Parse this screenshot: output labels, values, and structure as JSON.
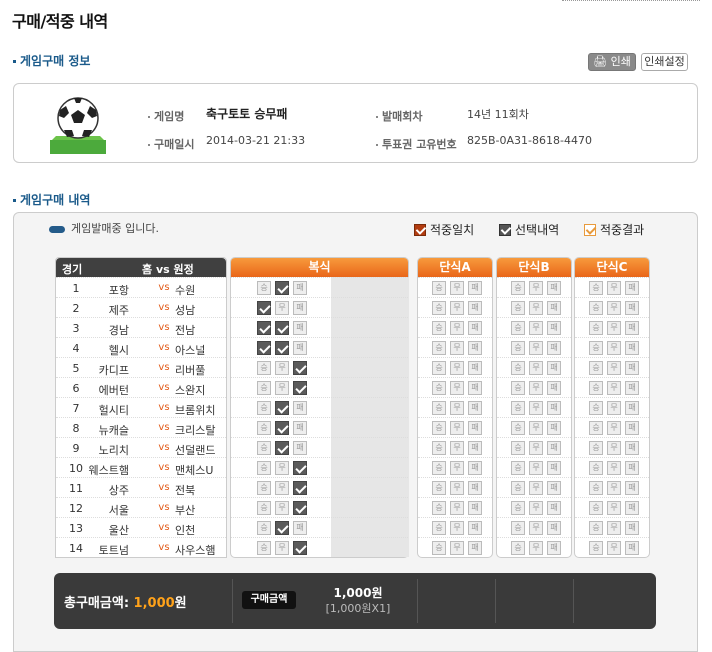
{
  "page_title": "구매/적중 내역",
  "info_section": {
    "title": "게임구매 정보",
    "print_label": "인쇄",
    "print_settings_label": "인쇄설정",
    "game_name_label": "게임명",
    "game_name": "축구토토 승무패",
    "round_label": "발매회차",
    "round": "14년 11회차",
    "purchase_time_label": "구매일시",
    "purchase_time": "2014-03-21 21:33",
    "ticket_id_label": "투표권 고유번호",
    "ticket_id": "825B-0A31-8618-4470"
  },
  "detail_section": {
    "title": "게임구매 내역",
    "status": "게임발매중 입니다.",
    "legend": {
      "hit_match": "적중일치",
      "selected": "선택내역",
      "hit_result": "적중결과"
    }
  },
  "table_headers": {
    "no": "경기",
    "home_vs_away": "홈 vs 원정",
    "multi": "복식",
    "single_a": "단식A",
    "single_b": "단식B",
    "single_c": "단식C"
  },
  "option_labels": {
    "win": "승",
    "draw": "무",
    "lose": "패"
  },
  "vs_text": "vs",
  "matches": [
    {
      "no": "1",
      "home": "포항",
      "away": "수원",
      "picks": [
        false,
        true,
        false
      ]
    },
    {
      "no": "2",
      "home": "제주",
      "away": "성남",
      "picks": [
        true,
        false,
        false
      ]
    },
    {
      "no": "3",
      "home": "경남",
      "away": "전남",
      "picks": [
        true,
        true,
        false
      ]
    },
    {
      "no": "4",
      "home": "헬시",
      "away": "아스널",
      "picks": [
        true,
        true,
        false
      ]
    },
    {
      "no": "5",
      "home": "카디프",
      "away": "리버풀",
      "picks": [
        false,
        false,
        true
      ]
    },
    {
      "no": "6",
      "home": "에버턴",
      "away": "스완지",
      "picks": [
        false,
        false,
        true
      ]
    },
    {
      "no": "7",
      "home": "헐시티",
      "away": "브롬위치",
      "picks": [
        false,
        true,
        false
      ]
    },
    {
      "no": "8",
      "home": "뉴캐슬",
      "away": "크리스탈",
      "picks": [
        false,
        true,
        false
      ]
    },
    {
      "no": "9",
      "home": "노리치",
      "away": "선덜랜드",
      "picks": [
        false,
        true,
        false
      ]
    },
    {
      "no": "10",
      "home": "웨스트햄",
      "away": "맨체스U",
      "picks": [
        false,
        false,
        true
      ]
    },
    {
      "no": "11",
      "home": "상주",
      "away": "전북",
      "picks": [
        false,
        false,
        true
      ]
    },
    {
      "no": "12",
      "home": "서울",
      "away": "부산",
      "picks": [
        false,
        false,
        true
      ]
    },
    {
      "no": "13",
      "home": "울산",
      "away": "인천",
      "picks": [
        false,
        true,
        false
      ]
    },
    {
      "no": "14",
      "home": "토트넘",
      "away": "사우스햄",
      "picks": [
        false,
        false,
        true
      ]
    }
  ],
  "summary": {
    "total_label": "총구매금액",
    "total_amount": "1,000",
    "currency": "원",
    "badge": "구매금액",
    "amount_line": "1,000원",
    "amount_detail": "[1,000원X1]"
  },
  "colors": {
    "accent": "#e9661a",
    "section_title": "#1a5a8a",
    "vs": "#e25a18"
  }
}
